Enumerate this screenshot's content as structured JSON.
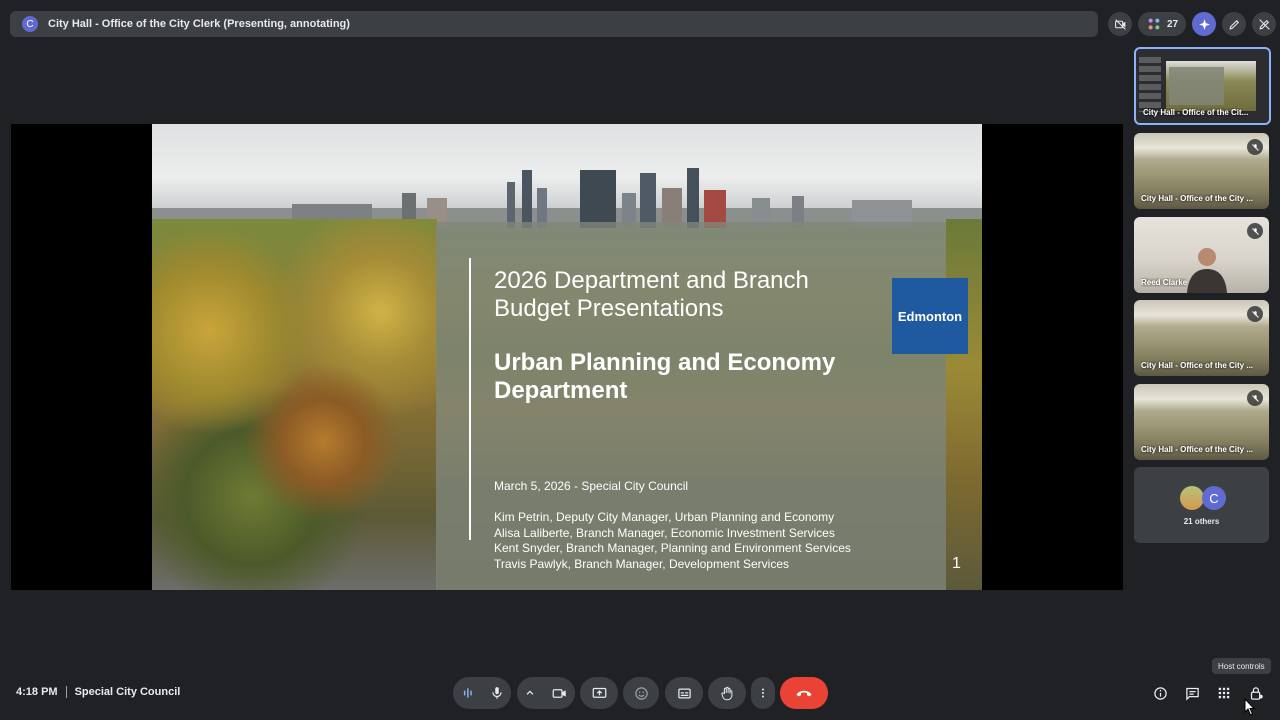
{
  "header": {
    "avatar_letter": "C",
    "title": "City Hall - Office of the City Clerk (Presenting, annotating)",
    "participant_count": "27"
  },
  "slide": {
    "title_line1": "2026 Department and Branch",
    "title_line2": "Budget Presentations",
    "subtitle_line1": "Urban Planning and Economy",
    "subtitle_line2": "Department",
    "date_line": "March 5, 2026 - Special City Council",
    "presenters": [
      "Kim Petrin, Deputy City Manager, Urban Planning and Economy",
      "Alisa Laliberte, Branch Manager, Economic Investment Services",
      "Kent Snyder, Branch Manager, Planning and Environment Services",
      "Travis Pawlyk, Branch Manager, Development Services"
    ],
    "logo_text": "Edmonton",
    "page_number": "1"
  },
  "participants": [
    {
      "name": "City Hall - Office of the Cit..."
    },
    {
      "name": "City Hall - Office of the City ..."
    },
    {
      "name": "Reed Clarke"
    },
    {
      "name": "City Hall - Office of the City ..."
    },
    {
      "name": "City Hall - Office of the City ..."
    }
  ],
  "others": {
    "avatar_letter": "C",
    "label": "21 others"
  },
  "footer": {
    "time": "4:18 PM",
    "meeting_name": "Special City Council",
    "tooltip": "Host controls"
  },
  "colors": {
    "background": "#202124",
    "control": "#3c4043",
    "end_call": "#ea4335",
    "accent": "#5f6bd1",
    "logo": "#1f5aa0"
  }
}
